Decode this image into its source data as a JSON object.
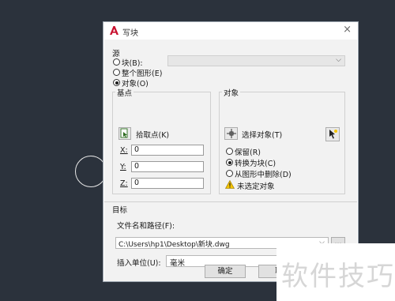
{
  "window": {
    "title": "写块",
    "close_symbol": "×"
  },
  "source": {
    "section_title": "源",
    "radio_block": "块(B):",
    "radio_entire": "整个图形(E)",
    "radio_objects": "对象(O)",
    "selected": "objects",
    "block_combo_value": ""
  },
  "basepoint": {
    "title": "基点",
    "pick_label": "拾取点(K)",
    "x_label": "X:",
    "y_label": "Y:",
    "z_label": "Z:",
    "x_value": "0",
    "y_value": "0",
    "z_value": "0"
  },
  "objects": {
    "title": "对象",
    "select_label": "选择对象(T)",
    "retain": "保留(R)",
    "convert": "转换为块(C)",
    "delete": "从图形中删除(D)",
    "selected": "convert",
    "warning_text": "未选定对象"
  },
  "destination": {
    "title": "目标",
    "filename_label": "文件名和路径(F):",
    "filename_value": "C:\\Users\\hp1\\Desktop\\新块.dwg",
    "browse_label": "...",
    "units_label": "插入单位(U):",
    "units_value": "毫米"
  },
  "buttons": {
    "ok": "确定",
    "cancel": "取"
  },
  "watermark": "软件技巧",
  "colors": {
    "background": "#2b323c",
    "accent_red": "#c8102e",
    "warning": "#f5c400"
  }
}
